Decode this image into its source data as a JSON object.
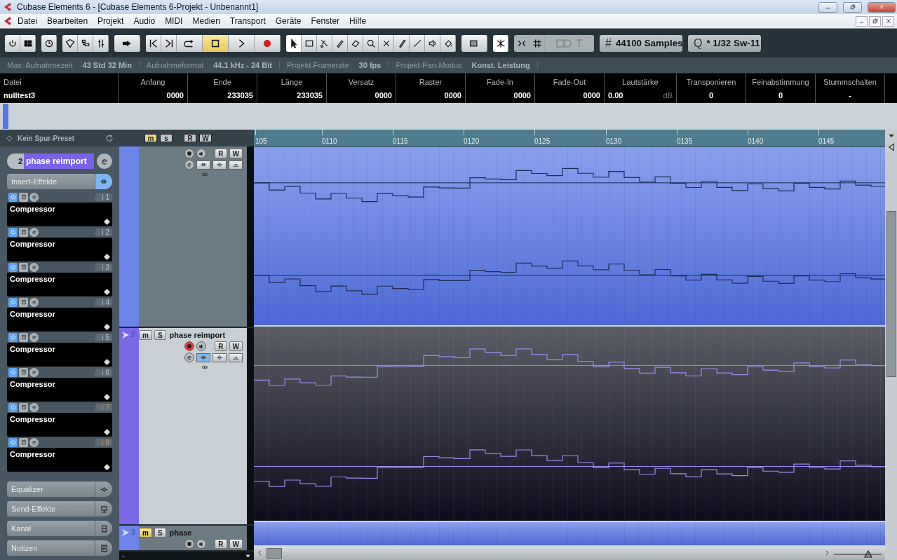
{
  "window": {
    "title": "Cubase Elements 6 - [Cubase Elements 6-Projekt - Unbenannt1]"
  },
  "menu": [
    "Datei",
    "Bearbeiten",
    "Projekt",
    "Audio",
    "MIDI",
    "Medien",
    "Transport",
    "Geräte",
    "Fenster",
    "Hilfe"
  ],
  "transport": [
    {
      "kind": "start",
      "selected": false
    },
    {
      "kind": "end",
      "selected": false
    },
    {
      "kind": "cycle",
      "selected": false
    },
    {
      "kind": "stop",
      "selected": true
    },
    {
      "kind": "play",
      "selected": false
    },
    {
      "kind": "record",
      "selected": false
    }
  ],
  "tools": [
    {
      "kind": "arrow",
      "selected": true
    },
    {
      "kind": "range",
      "selected": false
    },
    {
      "kind": "split",
      "selected": false
    },
    {
      "kind": "glue",
      "selected": false
    },
    {
      "kind": "erase",
      "selected": false
    },
    {
      "kind": "zoom",
      "selected": false
    },
    {
      "kind": "mute",
      "selected": false
    },
    {
      "kind": "draw",
      "selected": false
    },
    {
      "kind": "line",
      "selected": false
    },
    {
      "kind": "speaker",
      "selected": false
    },
    {
      "kind": "color",
      "selected": false
    }
  ],
  "grid": {
    "icon": "#",
    "value": "44100 Samples"
  },
  "quantize": {
    "icon": "Q",
    "value": "* 1/32  Sw-11"
  },
  "status_line": [
    {
      "label": "Max. Aufnahmezeit",
      "value": "43 Std 32 Min"
    },
    {
      "label": "Aufnahmeformat",
      "value": "44.1 kHz - 24 Bit"
    },
    {
      "label": "Projekt-Framerate",
      "value": "30 fps"
    },
    {
      "label": "Projekt-Pan-Modus",
      "value": "Konst. Leistung"
    }
  ],
  "info_line": [
    {
      "label": "Datei",
      "value": "nulltest3",
      "kind": "name"
    },
    {
      "label": "Anfang",
      "value": "0000",
      "kind": "time"
    },
    {
      "label": "Ende",
      "value": "233035",
      "kind": "time"
    },
    {
      "label": "Länge",
      "value": "233035",
      "kind": "time"
    },
    {
      "label": "Versatz",
      "value": "0000",
      "kind": "time"
    },
    {
      "label": "Raster",
      "value": "0000",
      "kind": "time"
    },
    {
      "label": "Fade-In",
      "value": "0000",
      "kind": "time"
    },
    {
      "label": "Fade-Out",
      "value": "0000",
      "kind": "time"
    },
    {
      "label": "Lautstärke",
      "value": "0.00",
      "unit": "dB",
      "kind": "gain"
    },
    {
      "label": "Transponieren",
      "value": "0",
      "kind": "value"
    },
    {
      "label": "Feinabstimmung",
      "value": "0",
      "kind": "value"
    },
    {
      "label": "Stummschalten",
      "value": "-",
      "kind": "value"
    }
  ],
  "inspector": {
    "preset": "Kein Spur-Preset",
    "track_number": "2",
    "track_name": "phase reimport",
    "insert_header": "Insert-Effekte",
    "inserts": [
      {
        "name": "Compressor",
        "slot": "i 1",
        "on": true,
        "post_fader": false
      },
      {
        "name": "Compressor",
        "slot": "i 2",
        "on": true,
        "post_fader": false
      },
      {
        "name": "Compressor",
        "slot": "i 3",
        "on": true,
        "post_fader": false
      },
      {
        "name": "Compressor",
        "slot": "i 4",
        "on": true,
        "post_fader": false
      },
      {
        "name": "Compressor",
        "slot": "i 5",
        "on": true,
        "post_fader": false
      },
      {
        "name": "Compressor",
        "slot": "i 6",
        "on": true,
        "post_fader": false
      },
      {
        "name": "Compressor",
        "slot": "i 7",
        "on": true,
        "post_fader": true
      },
      {
        "name": "Compressor",
        "slot": "i 8",
        "on": true,
        "post_fader": true
      }
    ],
    "sections": [
      {
        "label": "Equalizer",
        "kind": "eq"
      },
      {
        "label": "Send-Effekte",
        "kind": "send"
      },
      {
        "label": "Kanal",
        "kind": "channel"
      },
      {
        "label": "Notizen",
        "kind": "notes"
      }
    ]
  },
  "global_buttons": [
    {
      "label": "m",
      "selected": true
    },
    {
      "label": "s",
      "selected": false
    },
    {
      "label": "R",
      "selected": false
    },
    {
      "label": "W",
      "selected": false
    }
  ],
  "tracks": [
    {
      "color": "#6a84e8",
      "selected": false,
      "record": false,
      "event_selected": false,
      "read_label": "R",
      "write_label": "W"
    },
    {
      "number": "2",
      "name": "phase reimport",
      "color": "#7a68e6",
      "selected": true,
      "mute": false,
      "record": true,
      "event_selected": true,
      "mute_label": "m",
      "solo_label": "S",
      "read_label": "R",
      "write_label": "W"
    },
    {
      "number": "3",
      "name": "phase",
      "color": "#6a84e8",
      "selected": false,
      "mute": true,
      "record": false,
      "event_selected": false,
      "mute_label": "m",
      "solo_label": "S",
      "read_label": "R",
      "write_label": "W"
    }
  ],
  "track_list_footer": "-",
  "ruler": [
    "105",
    "0110",
    "0115",
    "0120",
    "0125",
    "0130",
    "0135",
    "0140",
    "0145"
  ]
}
